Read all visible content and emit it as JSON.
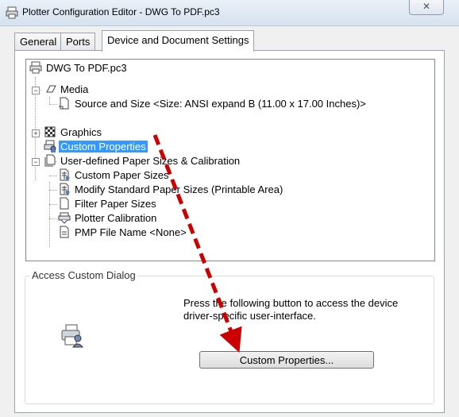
{
  "window": {
    "title": "Plotter Configuration Editor - DWG To PDF.pc3",
    "close_glyph": "✕"
  },
  "tabs": [
    {
      "label": "General",
      "active": false
    },
    {
      "label": "Ports",
      "active": false
    },
    {
      "label": "Device and Document Settings",
      "active": true
    }
  ],
  "tree": {
    "root": "DWG To PDF.pc3",
    "media": "Media",
    "source_size": "Source and Size <Size: ANSI expand B (11.00 x 17.00 Inches)>",
    "graphics": "Graphics",
    "custom_properties": "Custom Properties",
    "user_defined": "User-defined Paper Sizes & Calibration",
    "custom_paper_sizes": "Custom Paper Sizes",
    "modify_standard": "Modify Standard Paper Sizes (Printable Area)",
    "filter_paper_sizes": "Filter Paper Sizes",
    "plotter_calibration": "Plotter Calibration",
    "pmp_file": "PMP File Name <None>"
  },
  "group": {
    "legend": "Access Custom Dialog",
    "description": "Press the following button to access the device driver-specific user-interface.",
    "button_label": "Custom Properties..."
  },
  "colors": {
    "selection": "#3399ff",
    "annotation_arrow": "#cc0000"
  }
}
